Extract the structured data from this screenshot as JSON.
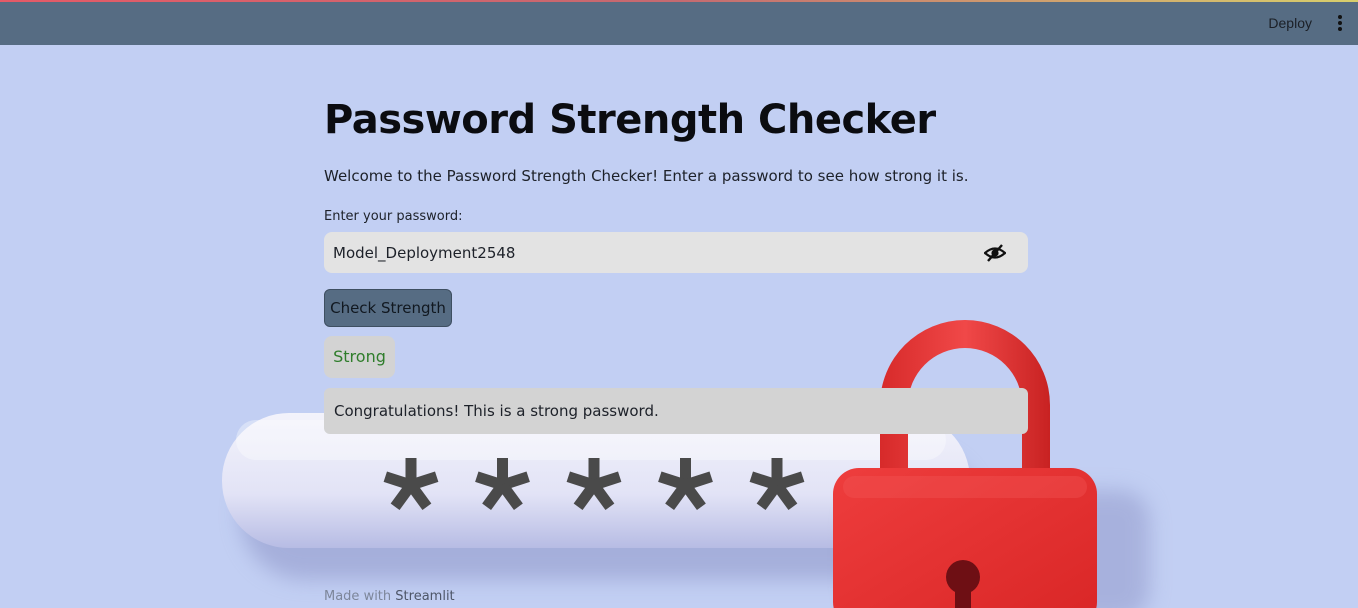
{
  "header": {
    "deploy_label": "Deploy",
    "menu_icon": "vertical-dots-icon",
    "bg_color": "#566c83"
  },
  "main": {
    "title": "Password Strength Checker",
    "intro": "Welcome to the Password Strength Checker! Enter a password to see how strong it is.",
    "password_label": "Enter your password:",
    "password_value": "Model_Deployment2548",
    "visibility_icon": "eye-slash-icon",
    "check_button_label": "Check Strength",
    "strength_result": "Strong",
    "message": "Congratulations! This is a strong password."
  },
  "illustration": {
    "asterisks": [
      "*",
      "*",
      "*",
      "*",
      "*"
    ],
    "icons": [
      "password-field-illustration",
      "padlock-icon"
    ],
    "lock_color": "#e23434"
  },
  "footer": {
    "made_with": "Made with",
    "brand": "Streamlit"
  },
  "colors": {
    "page_bg": "#c2cff3",
    "field_bg": "#e3e3e3",
    "success_text": "#2f7d2b"
  }
}
